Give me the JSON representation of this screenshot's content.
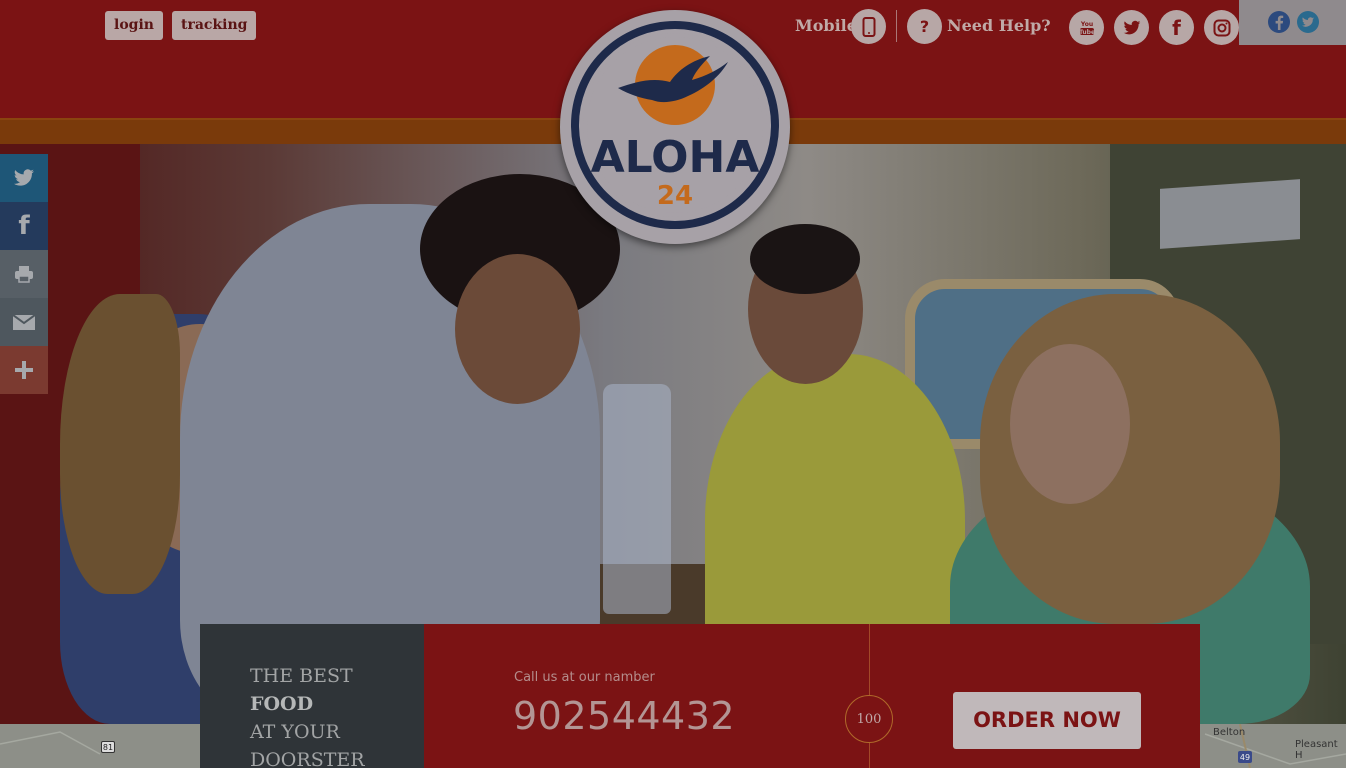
{
  "header": {
    "login_label": "login",
    "tracking_label": "tracking",
    "mobile_label": "Mobile",
    "help_label": "Need Help?",
    "help_glyph": "?",
    "social_icons": [
      "youtube-icon",
      "twitter-icon",
      "facebook-icon",
      "instagram-icon"
    ]
  },
  "logo": {
    "name": "ALOHA",
    "number": "24"
  },
  "share_bar": {
    "items": [
      "twitter-icon",
      "facebook-icon",
      "print-icon",
      "email-icon",
      "plus-icon"
    ]
  },
  "tagline": {
    "line1": "THE BEST",
    "line2": "FOOD",
    "line3": "AT YOUR",
    "line4": "DOORSTER"
  },
  "cta": {
    "subtitle": "Call us at our namber",
    "phone": "902544432",
    "badge": "100",
    "order_label": "ORDER NOW"
  },
  "map": {
    "label_belton": "Belton",
    "label_pleasant": "Pleasant H",
    "shield_left": "81",
    "shield_right": "49"
  },
  "colors": {
    "brand_red": "#7b1314",
    "accent_orange": "#7a3a0b",
    "logo_navy": "#1e2a4a",
    "logo_orange": "#c46a1c"
  }
}
